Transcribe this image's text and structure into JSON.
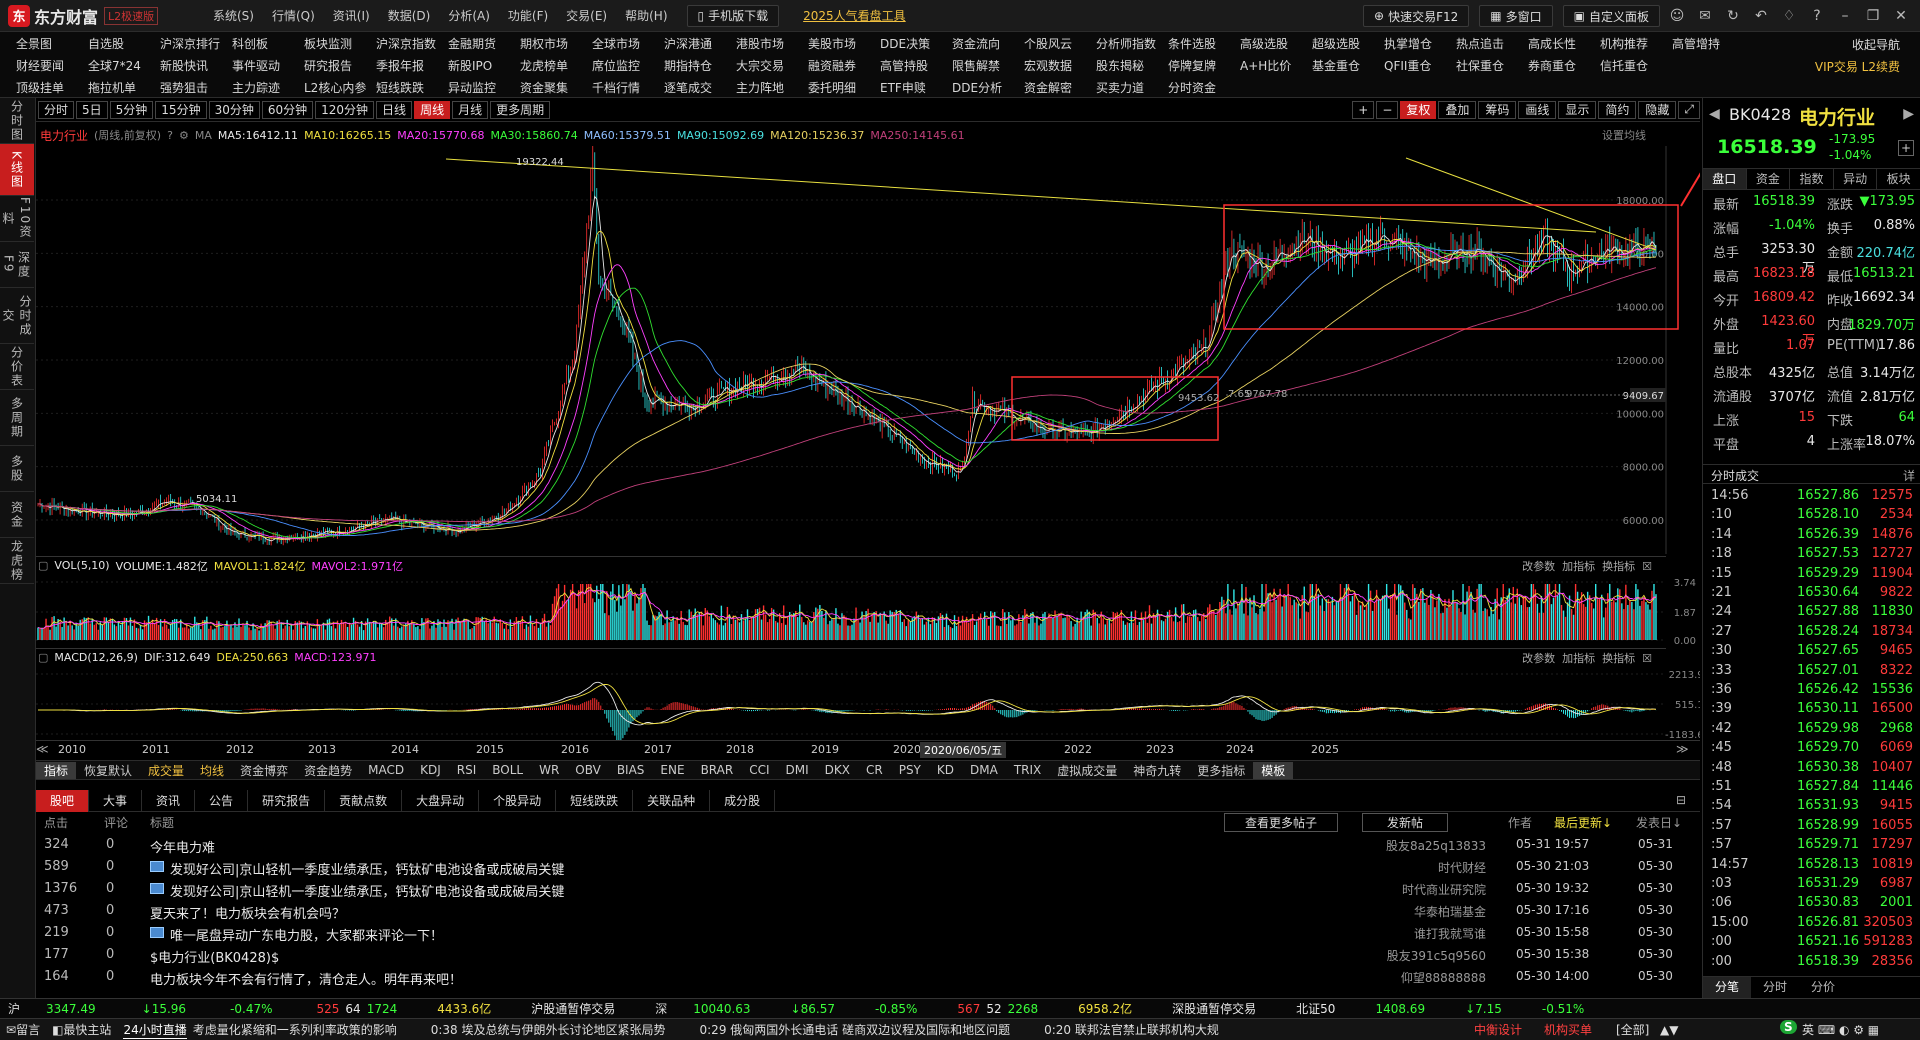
{
  "app": {
    "logo_mark": "东",
    "logo_name": "东方财富",
    "edition": "L2极速版",
    "menu": [
      "系统(S)",
      "行情(Q)",
      "资讯(I)",
      "数据(D)",
      "分析(A)",
      "功能(F)",
      "交易(E)",
      "帮助(H)"
    ],
    "mobile_btn": "手机版下载",
    "promo_link": "2025人气看盘工具",
    "quick_trade": "快速交易F12",
    "multi_window": "多窗口",
    "custom_panel": "自定义面板"
  },
  "nav": {
    "row1": [
      "全景图",
      "自选股",
      "沪深京排行",
      "科创板",
      "板块监测",
      "沪深京指数",
      "金融期货",
      "期权市场",
      "全球市场",
      "沪深港通",
      "港股市场",
      "美股市场",
      "DDE决策",
      "资金流向",
      "个股风云",
      "分析师指数",
      "条件选股",
      "高级选股",
      "超级选股",
      "执掌增仓",
      "热点追击",
      "高成长性",
      "机构推荐",
      "高管增持"
    ],
    "row2": [
      "财经要闻",
      "全球7*24",
      "新股快讯",
      "事件驱动",
      "研究报告",
      "季报年报",
      "新股IPO",
      "龙虎榜单",
      "席位监控",
      "期指持仓",
      "大宗交易",
      "融资融券",
      "高管持股",
      "限售解禁",
      "宏观数据",
      "股东揭秘",
      "停牌复牌",
      "A+H比价",
      "基金重仓",
      "QFII重仓",
      "社保重仓",
      "券商重仓",
      "信托重仓"
    ],
    "row3": [
      "顶级挂单",
      "拖拉机单",
      "强势狙击",
      "主力踪迹",
      "L2核心内参",
      "短线跌跌",
      "异动监控",
      "资金聚集",
      "千档行情",
      "逐笔成交",
      "主力阵地",
      "委托明细",
      "ETF申赎",
      "DDE分析",
      "资金解密",
      "买卖力道",
      "分时资金"
    ],
    "right1": "收起导航",
    "right2": "VIP交易 L2续费"
  },
  "leftbar": [
    "分时图",
    "K线图",
    "F10资料",
    "深度F9",
    "分时成交",
    "分价表",
    "多周期",
    "多股",
    "资金",
    "龙虎榜"
  ],
  "periods": [
    "分时",
    "5日",
    "5分钟",
    "15分钟",
    "30分钟",
    "60分钟",
    "120分钟",
    "日线",
    "周线",
    "月线",
    "更多周期"
  ],
  "toolbar": [
    "复权",
    "叠加",
    "筹码",
    "画线",
    "显示",
    "简约",
    "隐藏"
  ],
  "ma": {
    "name": "电力行业",
    "type": "(周线,前复权)",
    "ma5": "MA5:16412.11",
    "ma10": "MA10:16265.15",
    "ma20": "MA20:15770.68",
    "ma30": "MA30:15860.74",
    "ma60": "MA60:15379.51",
    "ma90": "MA90:15092.69",
    "ma120": "MA120:15236.37",
    "ma250": "MA250:14145.61",
    "settings": "设置均线"
  },
  "kchart": {
    "high_label": "19322.44",
    "low_label": "5034.11",
    "mid_label": "9767.78",
    "mid_label2": "7.65",
    "mid_label3": "9453.62",
    "price_tag": "9409.67",
    "yticks": [
      "18000.00",
      "16000.00",
      "14000.00",
      "12000.00",
      "10000.00",
      "8000.00",
      "6000.00"
    ]
  },
  "vol": {
    "label": "VOL(5,10)",
    "vol": "VOLUME:1.482亿",
    "mavol1": "MAVOL1:1.824亿",
    "mavol2": "MAVOL2:1.971亿",
    "yticks": [
      "3.74",
      "1.87",
      "0.00"
    ]
  },
  "macd": {
    "label": "MACD(12,26,9)",
    "dif": "DIF:312.649",
    "dea": "DEA:250.663",
    "macd": "MACD:123.971",
    "yticks": [
      "2213.95",
      "515.15",
      "-1183.66"
    ]
  },
  "panel_links": [
    "改参数",
    "加指标",
    "换指标"
  ],
  "xaxis": {
    "years": [
      "2010",
      "2011",
      "2012",
      "2013",
      "2014",
      "2015",
      "2016",
      "2017",
      "2018",
      "2019",
      "2020",
      "2022",
      "2023",
      "2024",
      "2025"
    ],
    "cursor_date": "2020/06/05/五"
  },
  "indicators": [
    "指标",
    "恢复默认",
    "成交量",
    "均线",
    "资金博弈",
    "资金趋势",
    "MACD",
    "KDJ",
    "RSI",
    "BOLL",
    "WR",
    "OBV",
    "BIAS",
    "ENE",
    "BRAR",
    "CCI",
    "DMI",
    "DKX",
    "CR",
    "PSY",
    "KD",
    "DMA",
    "TRIX",
    "虚拟成交量",
    "神奇九转",
    "更多指标",
    "模板"
  ],
  "news": {
    "tabs": [
      "股吧",
      "大事",
      "资讯",
      "公告",
      "研究报告",
      "贡献点数",
      "大盘异动",
      "个股异动",
      "短线跌跌",
      "关联品种",
      "成分股"
    ],
    "hdr": {
      "click": "点击",
      "comment": "评论",
      "title": "标题",
      "view_more": "查看更多帖子",
      "post": "发新帖",
      "author": "作者",
      "updated": "最后更新↓",
      "posted": "发表日↓"
    },
    "rows": [
      {
        "clicks": "324",
        "comments": "0",
        "title": "今年电力难",
        "author": "股友8a25q13833",
        "upd": "05-31 19:57",
        "date": "05-31",
        "pic": false
      },
      {
        "clicks": "589",
        "comments": "0",
        "title": "发现好公司|京山轻机一季度业绩承压，钙钛矿电池设备或成破局关键",
        "author": "时代财经",
        "upd": "05-30 21:03",
        "date": "05-30",
        "pic": true
      },
      {
        "clicks": "1376",
        "comments": "0",
        "title": "发现好公司|京山轻机一季度业绩承压，钙钛矿电池设备或成破局关键",
        "author": "时代商业研究院",
        "upd": "05-30 19:32",
        "date": "05-30",
        "pic": true
      },
      {
        "clicks": "473",
        "comments": "0",
        "title": "夏天来了！电力板块会有机会吗？",
        "author": "华泰柏瑞基金",
        "upd": "05-30 17:16",
        "date": "05-30",
        "pic": false
      },
      {
        "clicks": "219",
        "comments": "0",
        "title": "唯一尾盘异动广东电力股，大家都来评论一下！",
        "author": "谁打我就骂谁",
        "upd": "05-30 15:58",
        "date": "05-30",
        "pic": true
      },
      {
        "clicks": "177",
        "comments": "0",
        "title": "$电力行业(BK0428)$",
        "author": "股友391c5q9560",
        "upd": "05-30 15:38",
        "date": "05-30",
        "pic": false
      },
      {
        "clicks": "164",
        "comments": "0",
        "title": "电力板块今年不会有行情了，清仓走人。明年再来吧！",
        "author": "仰望88888888",
        "upd": "05-30 14:00",
        "date": "05-30",
        "pic": false
      }
    ]
  },
  "status": {
    "sh": "沪",
    "sh_idx": "3347.49",
    "sh_chg": "15.96",
    "sh_pct": "-0.47%",
    "sh_up": "525",
    "sh_flat": "64",
    "sh_dn": "1724",
    "sh_amt": "4433.6亿",
    "hgt": "沪股通暂停交易",
    "sz": "深",
    "sz_idx": "10040.63",
    "sz_chg": "86.57",
    "sz_pct": "-0.85%",
    "sz_up": "567",
    "sz_flat": "52",
    "sz_dn": "2268",
    "sz_amt": "6958.2亿",
    "sgt": "深股通暂停交易",
    "bz": "北证50",
    "bz_idx": "1408.69",
    "bz_chg": "7.15",
    "bz_pct": "-0.51%"
  },
  "ticker": {
    "left": "留言",
    "back": "最快主站",
    "live": "24小时直播",
    "items": [
      "考虑量化紧缩和一系列利率政策的影响",
      "0:38 埃及总统与伊朗外长讨论地区紧张局势",
      "0:29 俄匈两国外长通电话 磋商双边议程及国际和地区问题",
      "0:20 联邦法官禁止联邦机构大规"
    ],
    "tags": [
      "中衡设计",
      "机构买单",
      "[全部]"
    ]
  },
  "quote": {
    "code": "BK0428",
    "name": "电力行业",
    "price": "16518.39",
    "chg": "-173.95",
    "pct": "-1.04%",
    "tabs": [
      "盘口",
      "资金",
      "指数",
      "异动",
      "板块"
    ],
    "rows": [
      {
        "l1": "最新",
        "v1": "16518.39",
        "c1": "grn",
        "l2": "涨跌",
        "v2": "▼173.95",
        "c2": "grn"
      },
      {
        "l1": "涨幅",
        "v1": "-1.04%",
        "c1": "grn",
        "l2": "换手",
        "v2": "0.88%",
        "c2": "wht"
      },
      {
        "l1": "总手",
        "v1": "3253.30万",
        "c1": "wht",
        "l2": "金额",
        "v2": "220.74亿",
        "c2": "cyn"
      },
      {
        "l1": "最高",
        "v1": "16823.18",
        "c1": "red",
        "l2": "最低",
        "v2": "16513.21",
        "c2": "grn"
      },
      {
        "l1": "今开",
        "v1": "16809.42",
        "c1": "red",
        "l2": "昨收",
        "v2": "16692.34",
        "c2": "wht"
      },
      {
        "l1": "外盘",
        "v1": "1423.60万",
        "c1": "red",
        "l2": "内盘",
        "v2": "1829.70万",
        "c2": "grn"
      },
      {
        "l1": "量比",
        "v1": "1.07",
        "c1": "red",
        "l2": "PE(TTM)",
        "v2": "17.86",
        "c2": "wht"
      },
      {
        "l1": "总股本",
        "v1": "4325亿",
        "c1": "wht",
        "l2": "总值",
        "v2": "3.14万亿",
        "c2": "wht"
      },
      {
        "l1": "流通股",
        "v1": "3707亿",
        "c1": "wht",
        "l2": "流值",
        "v2": "2.81万亿",
        "c2": "wht"
      },
      {
        "l1": "上涨",
        "v1": "15",
        "c1": "red",
        "l2": "下跌",
        "v2": "64",
        "c2": "grn"
      },
      {
        "l1": "平盘",
        "v1": "4",
        "c1": "wht",
        "l2": "上涨率",
        "v2": "18.07%",
        "c2": "wht"
      }
    ],
    "ticks_title": "分时成交",
    "ticks_btn": "详",
    "ticks": [
      {
        "t": "14:56",
        "p": "16527.86",
        "v": "12575",
        "pc": "grn",
        "vc": "red"
      },
      {
        "t": ":10",
        "p": "16528.10",
        "v": "2534",
        "pc": "grn",
        "vc": "red"
      },
      {
        "t": ":14",
        "p": "16526.39",
        "v": "14876",
        "pc": "grn",
        "vc": "red"
      },
      {
        "t": ":18",
        "p": "16527.53",
        "v": "12727",
        "pc": "grn",
        "vc": "red"
      },
      {
        "t": ":15",
        "p": "16529.29",
        "v": "11904",
        "pc": "grn",
        "vc": "red"
      },
      {
        "t": ":21",
        "p": "16530.64",
        "v": "9822",
        "pc": "grn",
        "vc": "red"
      },
      {
        "t": ":24",
        "p": "16527.88",
        "v": "11830",
        "pc": "grn",
        "vc": "grn"
      },
      {
        "t": ":27",
        "p": "16528.24",
        "v": "18734",
        "pc": "grn",
        "vc": "red"
      },
      {
        "t": ":30",
        "p": "16527.65",
        "v": "9465",
        "pc": "grn",
        "vc": "red"
      },
      {
        "t": ":33",
        "p": "16527.01",
        "v": "8322",
        "pc": "grn",
        "vc": "red"
      },
      {
        "t": ":36",
        "p": "16526.42",
        "v": "15536",
        "pc": "grn",
        "vc": "grn"
      },
      {
        "t": ":39",
        "p": "16530.11",
        "v": "16500",
        "pc": "grn",
        "vc": "red"
      },
      {
        "t": ":42",
        "p": "16529.98",
        "v": "2968",
        "pc": "grn",
        "vc": "grn"
      },
      {
        "t": ":45",
        "p": "16529.70",
        "v": "6069",
        "pc": "grn",
        "vc": "red"
      },
      {
        "t": ":48",
        "p": "16530.38",
        "v": "10407",
        "pc": "grn",
        "vc": "red"
      },
      {
        "t": ":51",
        "p": "16527.84",
        "v": "11446",
        "pc": "grn",
        "vc": "grn"
      },
      {
        "t": ":54",
        "p": "16531.93",
        "v": "9415",
        "pc": "grn",
        "vc": "red"
      },
      {
        "t": ":57",
        "p": "16528.99",
        "v": "16055",
        "pc": "grn",
        "vc": "red"
      },
      {
        "t": ":57",
        "p": "16529.71",
        "v": "17297",
        "pc": "grn",
        "vc": "red"
      },
      {
        "t": "14:57",
        "p": "16528.13",
        "v": "10819",
        "pc": "grn",
        "vc": "red"
      },
      {
        "t": ":03",
        "p": "16531.29",
        "v": "6987",
        "pc": "grn",
        "vc": "red"
      },
      {
        "t": ":06",
        "p": "16530.83",
        "v": "2001",
        "pc": "grn",
        "vc": "grn"
      },
      {
        "t": "15:00",
        "p": "16526.81",
        "v": "320503",
        "pc": "grn",
        "vc": "red"
      },
      {
        "t": ":00",
        "p": "16521.16",
        "v": "591283",
        "pc": "grn",
        "vc": "red"
      },
      {
        "t": ":00",
        "p": "16518.39",
        "v": "28356",
        "pc": "grn",
        "vc": "red"
      }
    ],
    "btabs": [
      "分笔",
      "分时",
      "分价"
    ]
  }
}
